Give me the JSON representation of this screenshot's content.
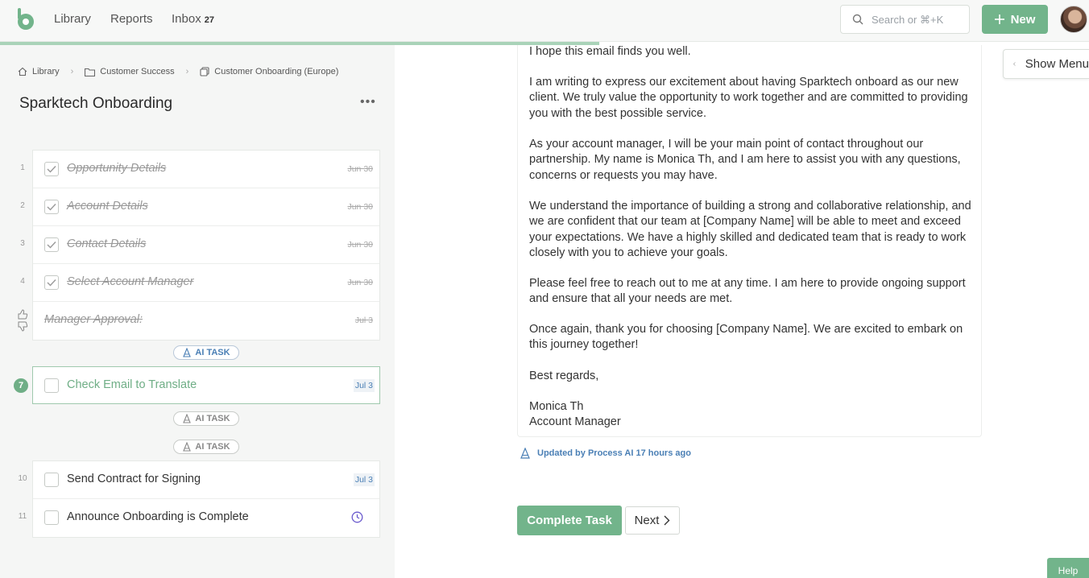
{
  "nav": {
    "links": [
      "Library",
      "Reports",
      "Inbox"
    ],
    "inbox_count": "27",
    "search_placeholder": "Search or ⌘+K",
    "new_label": "New",
    "progress_fraction": 0.55
  },
  "breadcrumb": [
    "Library",
    "Customer Success",
    "Customer Onboarding (Europe)"
  ],
  "page_title": "Sparktech Onboarding",
  "tasks_completed": [
    {
      "num": "1",
      "name": "Opportunity Details",
      "date": "Jun 30"
    },
    {
      "num": "2",
      "name": "Account Details",
      "date": "Jun 30"
    },
    {
      "num": "3",
      "name": "Contact Details",
      "date": "Jun 30"
    },
    {
      "num": "4",
      "name": "Select Account Manager",
      "date": "Jun 30"
    },
    {
      "num": "",
      "name": "Manager Approval:",
      "date": "Jul 3"
    }
  ],
  "ai_task_label": "AI TASK",
  "current_task": {
    "num": "7",
    "name": "Check Email to Translate",
    "date": "Jul 3"
  },
  "tasks_remaining": [
    {
      "num": "10",
      "name": "Send Contract for Signing",
      "date": "Jul 3"
    },
    {
      "num": "11",
      "name": "Announce Onboarding is Complete",
      "date": ""
    }
  ],
  "email": {
    "paragraphs": [
      "I hope this email finds you well.",
      "I am writing to express our excitement about having Sparktech onboard as our new client. We truly value the opportunity to work together and are committed to providing you with the best possible service.",
      "As your account manager, I will be your main point of contact throughout our partnership. My name is Monica Th, and I am here to assist you with any questions, concerns or requests you may have.",
      "We understand the importance of building a strong and collaborative relationship, and we are confident that our team at [Company Name] will be able to meet and exceed your expectations. We have a highly skilled and dedicated team that is ready to work closely with you to achieve your goals.",
      "Please feel free to reach out to me at any time. I am here to provide ongoing support and ensure that all your needs are met.",
      "Once again, thank you for choosing [Company Name]. We are excited to embark on this journey together!",
      "Best regards,",
      "Monica Th",
      "Account Manager"
    ]
  },
  "updated_text": "Updated by Process AI 17 hours ago",
  "complete_label": "Complete Task",
  "next_label": "Next",
  "show_menu_label": "Show Menu",
  "help_label": "Help",
  "colors": {
    "brand_green": "#72b48b",
    "link_blue": "#4a7fb5"
  }
}
